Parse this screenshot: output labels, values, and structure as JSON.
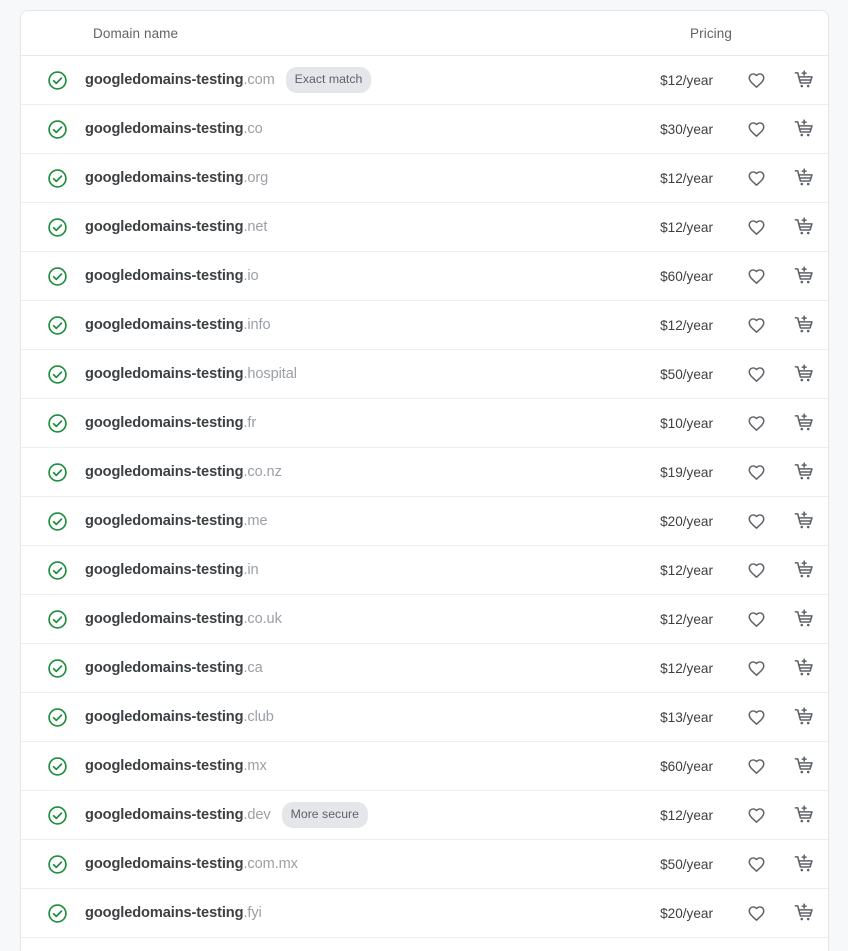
{
  "theme": {
    "page_bg": "#f6f8f9",
    "card_bg": "#ffffff",
    "available_green": "#1e8e3e",
    "text_primary": "#3c4043",
    "text_secondary": "#5f6368",
    "text_muted": "#9aa0a6",
    "badge_bg": "#e4e6e9",
    "divider": "#eceef0"
  },
  "table": {
    "columns": {
      "domain": "Domain name",
      "pricing": "Pricing"
    },
    "icons": {
      "status": "check-circle-icon",
      "favorite": "heart-icon",
      "cart": "add-to-cart-icon"
    },
    "rows": [
      {
        "base": "googledomains-testing",
        "tld": ".com",
        "price": "$12/year",
        "badge": "Exact match"
      },
      {
        "base": "googledomains-testing",
        "tld": ".co",
        "price": "$30/year",
        "badge": ""
      },
      {
        "base": "googledomains-testing",
        "tld": ".org",
        "price": "$12/year",
        "badge": ""
      },
      {
        "base": "googledomains-testing",
        "tld": ".net",
        "price": "$12/year",
        "badge": ""
      },
      {
        "base": "googledomains-testing",
        "tld": ".io",
        "price": "$60/year",
        "badge": ""
      },
      {
        "base": "googledomains-testing",
        "tld": ".info",
        "price": "$12/year",
        "badge": ""
      },
      {
        "base": "googledomains-testing",
        "tld": ".hospital",
        "price": "$50/year",
        "badge": ""
      },
      {
        "base": "googledomains-testing",
        "tld": ".fr",
        "price": "$10/year",
        "badge": ""
      },
      {
        "base": "googledomains-testing",
        "tld": ".co.nz",
        "price": "$19/year",
        "badge": ""
      },
      {
        "base": "googledomains-testing",
        "tld": ".me",
        "price": "$20/year",
        "badge": ""
      },
      {
        "base": "googledomains-testing",
        "tld": ".in",
        "price": "$12/year",
        "badge": ""
      },
      {
        "base": "googledomains-testing",
        "tld": ".co.uk",
        "price": "$12/year",
        "badge": ""
      },
      {
        "base": "googledomains-testing",
        "tld": ".ca",
        "price": "$12/year",
        "badge": ""
      },
      {
        "base": "googledomains-testing",
        "tld": ".club",
        "price": "$13/year",
        "badge": ""
      },
      {
        "base": "googledomains-testing",
        "tld": ".mx",
        "price": "$60/year",
        "badge": ""
      },
      {
        "base": "googledomains-testing",
        "tld": ".dev",
        "price": "$12/year",
        "badge": "More secure"
      },
      {
        "base": "googledomains-testing",
        "tld": ".com.mx",
        "price": "$50/year",
        "badge": ""
      },
      {
        "base": "googledomains-testing",
        "tld": ".fyi",
        "price": "$20/year",
        "badge": ""
      }
    ]
  }
}
